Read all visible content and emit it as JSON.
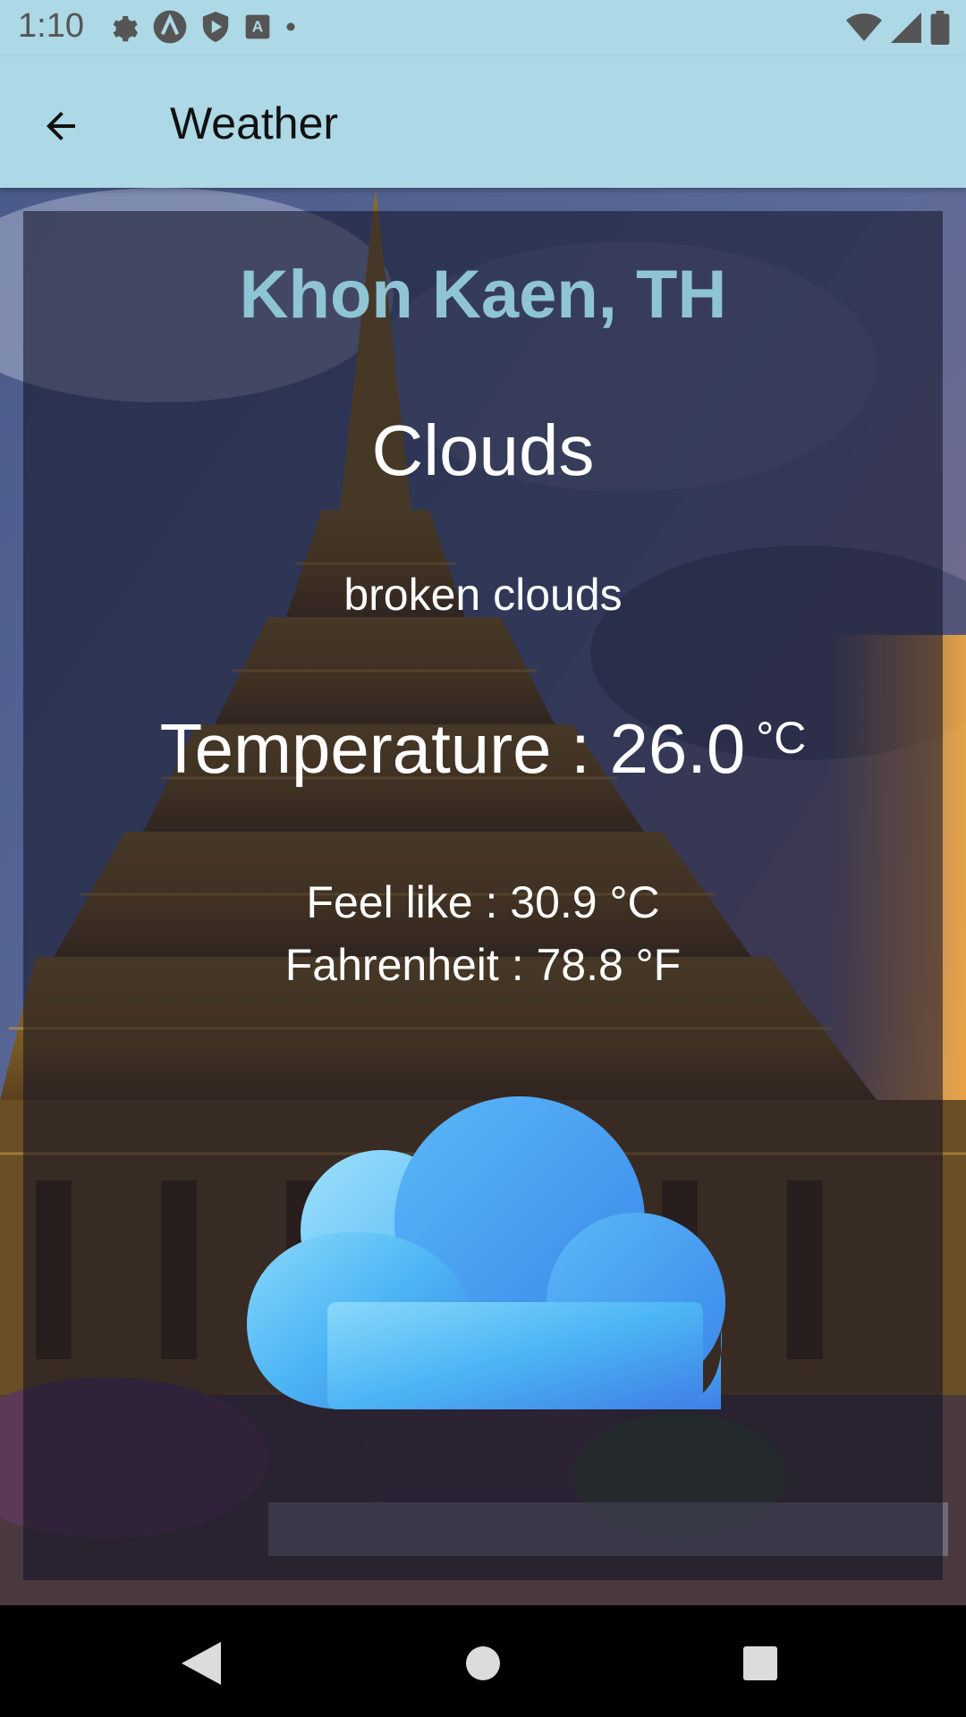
{
  "status_bar": {
    "time": "1:10",
    "left_icons": [
      "settings-icon",
      "app-a-icon",
      "shield-play-icon",
      "font-a-icon",
      "dot-icon"
    ],
    "right_icons": [
      "wifi-icon",
      "signal-icon",
      "battery-icon"
    ]
  },
  "app_bar": {
    "title": "Weather",
    "back_icon": "arrow-back-icon"
  },
  "weather": {
    "city": "Khon Kaen, TH",
    "main": "Clouds",
    "description": "broken clouds",
    "temperature_label": "Temperature : 26.0",
    "temperature_unit": "°C",
    "feels_like": "Feel like : 30.9 °C",
    "fahrenheit": "Fahrenheit : 78.8  °F",
    "icon": "cloud-icon"
  },
  "colors": {
    "app_bar": "#add8e6",
    "city_text": "#8fc4d4",
    "card_overlay": "#0f0f23",
    "nav_bar": "#000000"
  },
  "nav_bar": {
    "buttons": [
      "back-triangle-icon",
      "home-circle-icon",
      "recents-square-icon"
    ]
  }
}
